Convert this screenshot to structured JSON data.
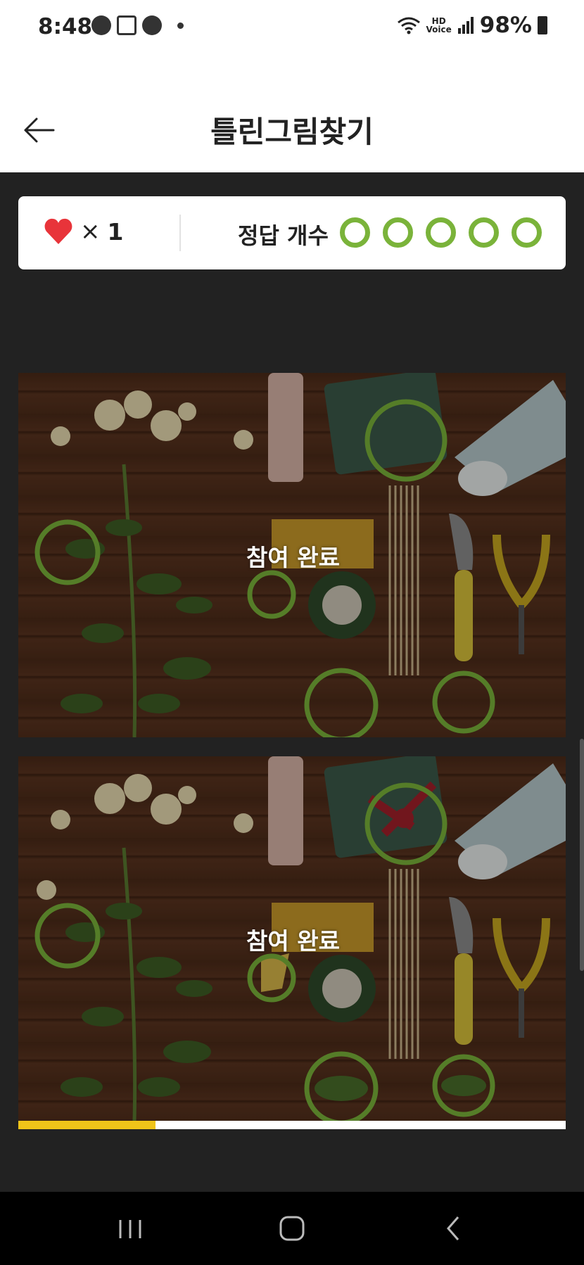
{
  "status_bar": {
    "time": "8:48",
    "hd_voice": "HD\nVoice",
    "battery": "98%"
  },
  "header": {
    "title": "틀린그림찾기"
  },
  "score": {
    "lives_multiplier": "×",
    "lives_count": "1",
    "answer_label": "정답 개수",
    "found_count": 5,
    "total": 5
  },
  "puzzle": {
    "top_overlay": "참여 완료",
    "bottom_overlay": "참여 완료"
  },
  "progress": {
    "fraction": 0.25
  },
  "colors": {
    "accent_green": "#7ab33a",
    "heart_red": "#e8343a",
    "progress_yellow": "#f0c419",
    "background": "#222222"
  },
  "icons": [
    "back-arrow-icon",
    "heart-icon",
    "recents-icon",
    "home-icon",
    "nav-back-icon"
  ]
}
